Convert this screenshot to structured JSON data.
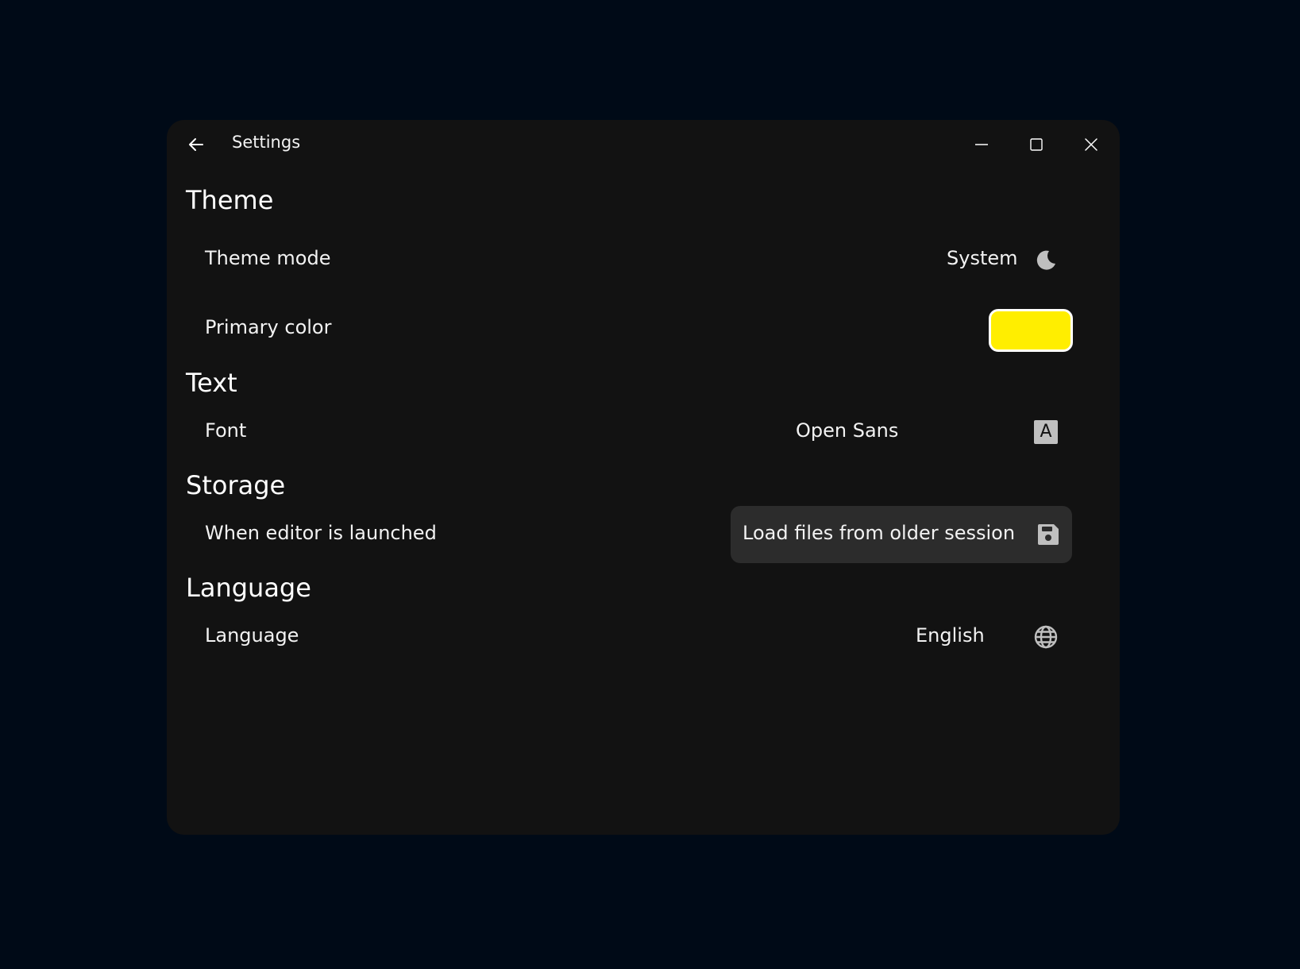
{
  "window": {
    "title": "Settings",
    "background": "#121212",
    "page_background": "#000a17"
  },
  "icons": {
    "back": "arrow-left-icon",
    "minimize": "minimize-icon",
    "maximize": "maximize-icon",
    "close": "close-icon",
    "theme_mode": "moon-icon",
    "font": "font-a-icon",
    "storage": "floppy-disk-icon",
    "language": "globe-icon"
  },
  "sections": {
    "theme": {
      "title": "Theme",
      "theme_mode_label": "Theme mode",
      "theme_mode_value": "System",
      "primary_color_label": "Primary color",
      "primary_color": "#ffee00"
    },
    "text": {
      "title": "Text",
      "font_label": "Font",
      "font_value": "Open Sans",
      "font_icon_letter": "A"
    },
    "storage": {
      "title": "Storage",
      "launch_label": "When editor is launched",
      "launch_value": "Load files from older session"
    },
    "language": {
      "title": "Language",
      "language_label": "Language",
      "language_value": "English"
    }
  }
}
